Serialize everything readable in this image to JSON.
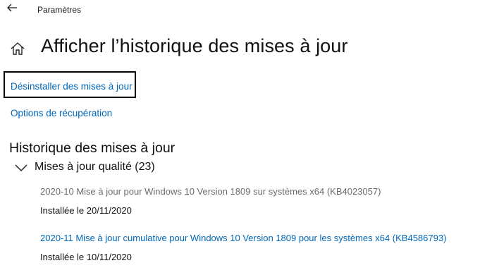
{
  "titlebar": {
    "back_icon": "back-arrow-icon",
    "title": "Paramètres"
  },
  "header": {
    "home_icon": "home-icon",
    "title": "Afficher l’historique des mises à jour"
  },
  "links": {
    "uninstall": "Désinstaller des mises à jour",
    "recovery": "Options de récupération"
  },
  "history": {
    "title": "Historique des mises à jour",
    "group": {
      "icon": "chevron-down-icon",
      "label": "Mises à jour qualité (23)",
      "expanded": true,
      "items": [
        {
          "name": "2020-10 Mise à jour pour Windows 10 Version 1809 sur systèmes x64 (KB4023057)",
          "status": "Installée le 20/11/2020"
        },
        {
          "name": "2020-11 Mise à jour cumulative pour Windows 10 Version 1809 pour les systèmes x64 (KB4586793)",
          "status": "Installée le 10/11/2020"
        }
      ]
    }
  },
  "colors": {
    "link": "#0067b8",
    "muted": "#6b6b6b",
    "text": "#111111",
    "highlight_border": "#000000"
  }
}
